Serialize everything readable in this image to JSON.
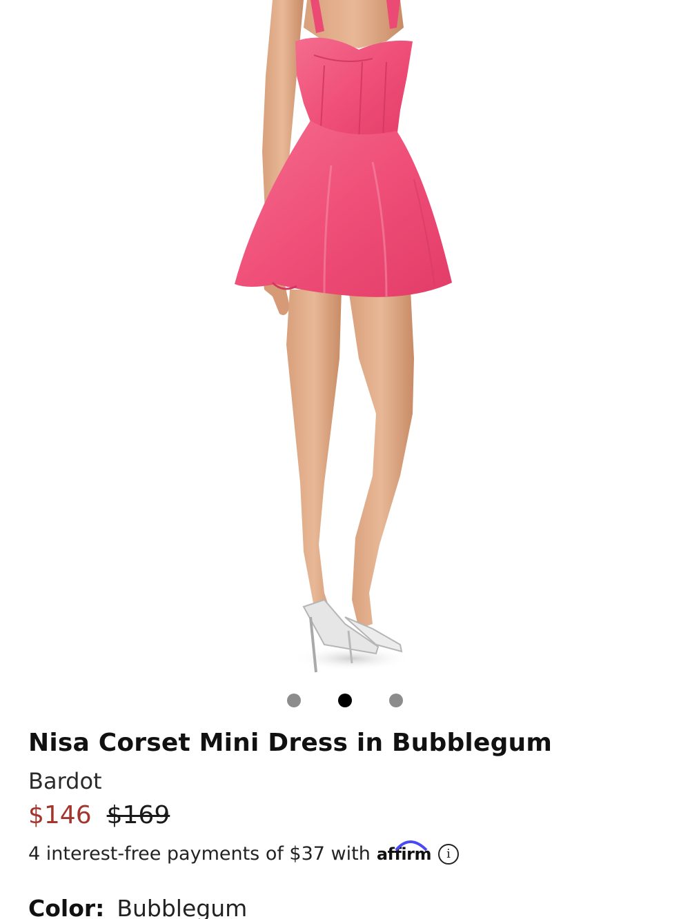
{
  "carousel": {
    "image_alt": "Model wearing pink corset mini dress with clear heels",
    "dots": [
      {
        "state": "inactive"
      },
      {
        "state": "active"
      },
      {
        "state": "inactive"
      }
    ]
  },
  "product": {
    "title": "Nisa Corset Mini Dress in Bubblegum",
    "brand": "Bardot",
    "price_sale": "$146",
    "price_original": "$169",
    "installments_text": "4 interest-free payments of $37 with",
    "affirm_label": "affirm",
    "info_symbol": "i",
    "color_label": "Color:",
    "color_value": "Bubblegum"
  },
  "colors": {
    "sale_price": "#a3352d",
    "dress_pink": "#f2557a",
    "affirm_blue": "#4a4af4"
  }
}
